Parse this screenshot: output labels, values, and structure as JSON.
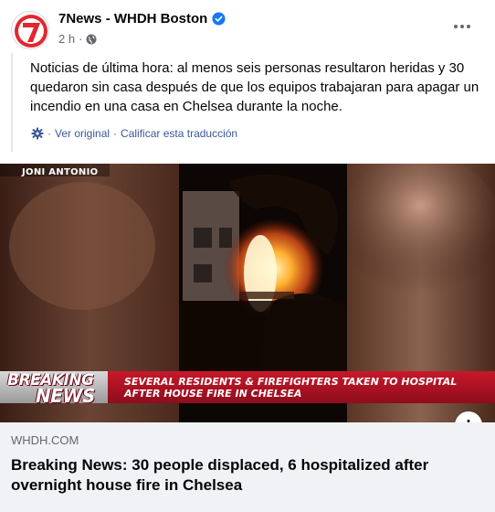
{
  "post": {
    "page_name": "7News - WHDH Boston",
    "time": "2 h",
    "dot": "·",
    "avatar_icon": "7news-logo-icon",
    "verified_icon": "verified-badge-icon",
    "privacy_icon": "globe-icon"
  },
  "translation": {
    "text": "Noticias de última hora: al menos seis personas resultaron heridas y 30 quedaron sin casa después de que los equipos trabajaran para apagar un incendio en una casa en Chelsea durante la noche.",
    "settings_icon": "gear-icon",
    "separator": "·",
    "see_original": "Ver original",
    "rate_translation": "Calificar esta traducción"
  },
  "media": {
    "video_label": "JONI ANTONIO",
    "breaking": "BREAKING",
    "news": "NEWS",
    "headline_line1": "SEVERAL RESIDENTS & FIREFIGHTERS TAKEN TO HOSPITAL",
    "headline_line2": "AFTER HOUSE FIRE IN CHELSEA",
    "info_label": "i"
  },
  "link_preview": {
    "domain": "WHDH.COM",
    "title": "Breaking News: 30 people displaced, 6 hospitalized after overnight house fire in Chelsea"
  },
  "colors": {
    "link": "#385898",
    "verified": "#1877f2",
    "breaking_red": "#c8182a",
    "preview_bg": "#f0f2f5"
  }
}
